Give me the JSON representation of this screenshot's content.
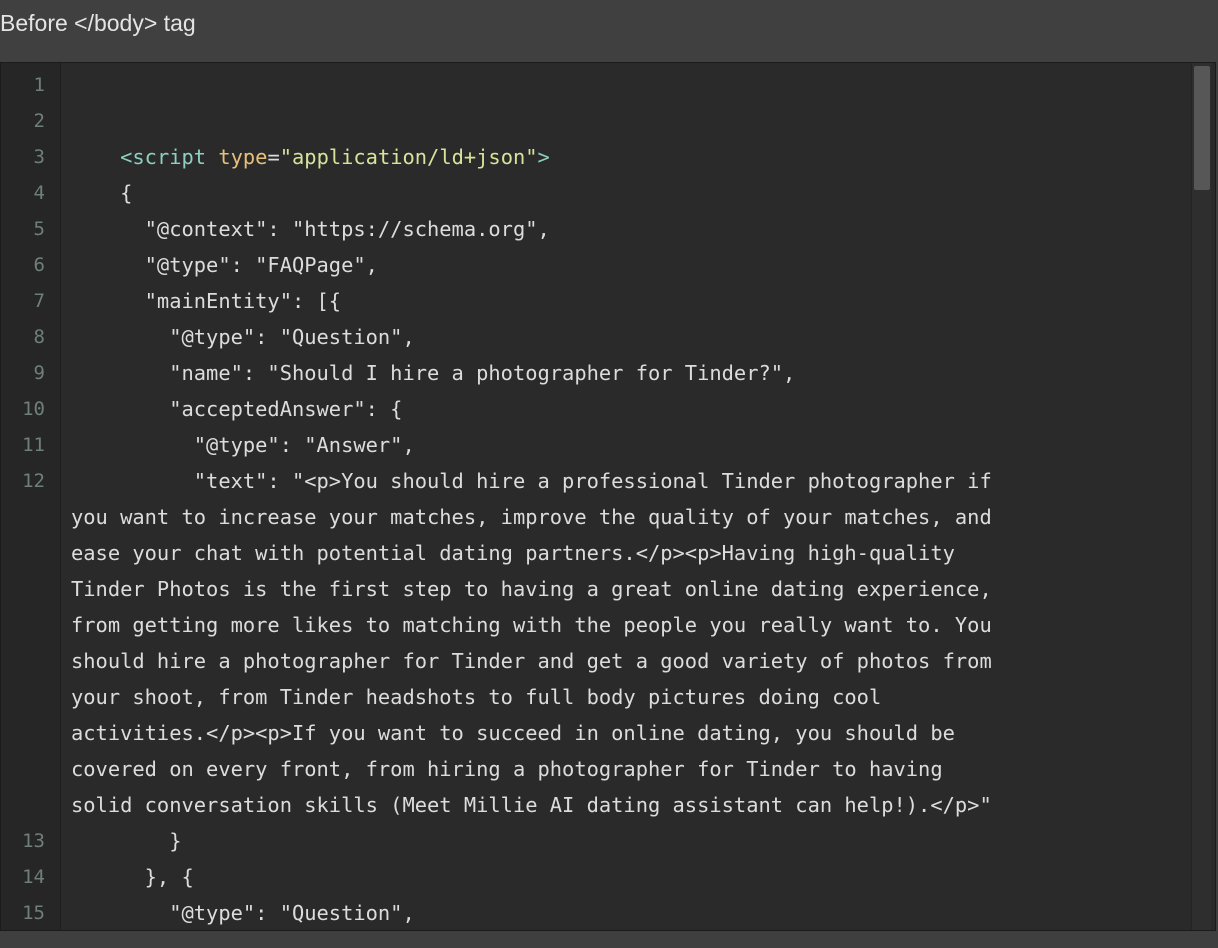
{
  "panel": {
    "title": "Before </body> tag"
  },
  "editor": {
    "line_numbers": [
      "1",
      "2",
      "3",
      "4",
      "5",
      "6",
      "7",
      "8",
      "9",
      "10",
      "11",
      "12",
      "13",
      "14",
      "15"
    ],
    "code": {
      "l3_open": "    <",
      "l3_tag": "script",
      "l3_attr": "type",
      "l3_eq": "=",
      "l3_str": "\"application/ld+json\"",
      "l3_close": ">",
      "l4": "    {",
      "l5": "      \"@context\": \"https://schema.org\",",
      "l6": "      \"@type\": \"FAQPage\",",
      "l7": "      \"mainEntity\": [{",
      "l8": "        \"@type\": \"Question\",",
      "l9": "        \"name\": \"Should I hire a photographer for Tinder?\",",
      "l10": "        \"acceptedAnswer\": {",
      "l11": "          \"@type\": \"Answer\",",
      "l12a": "          \"text\": \"<p>You should hire a professional Tinder photographer if",
      "l12b": "you want to increase your matches, improve the quality of your matches, and",
      "l12c": "ease your chat with potential dating partners.</p><p>Having high-quality",
      "l12d": "Tinder Photos is the first step to having a great online dating experience,",
      "l12e": "from getting more likes to matching with the people you really want to. You",
      "l12f": "should hire a photographer for Tinder and get a good variety of photos from",
      "l12g": "your shoot, from Tinder headshots to full body pictures doing cool",
      "l12h": "activities.</p><p>If you want to succeed in online dating, you should be",
      "l12i": "covered on every front, from hiring a photographer for Tinder to having",
      "l12j": "solid conversation skills (Meet Millie AI dating assistant can help!).</p>\"",
      "l13": "        }",
      "l14": "      }, {",
      "l15": "        \"@type\": \"Question\","
    }
  },
  "colors": {
    "background": "#2a2a2a",
    "gutter": "#262626",
    "line_number": "#6f7f7b",
    "tag": "#8ecfc0",
    "attribute": "#e6c07b",
    "string": "#d7e39a",
    "text": "#dcdcdc"
  }
}
